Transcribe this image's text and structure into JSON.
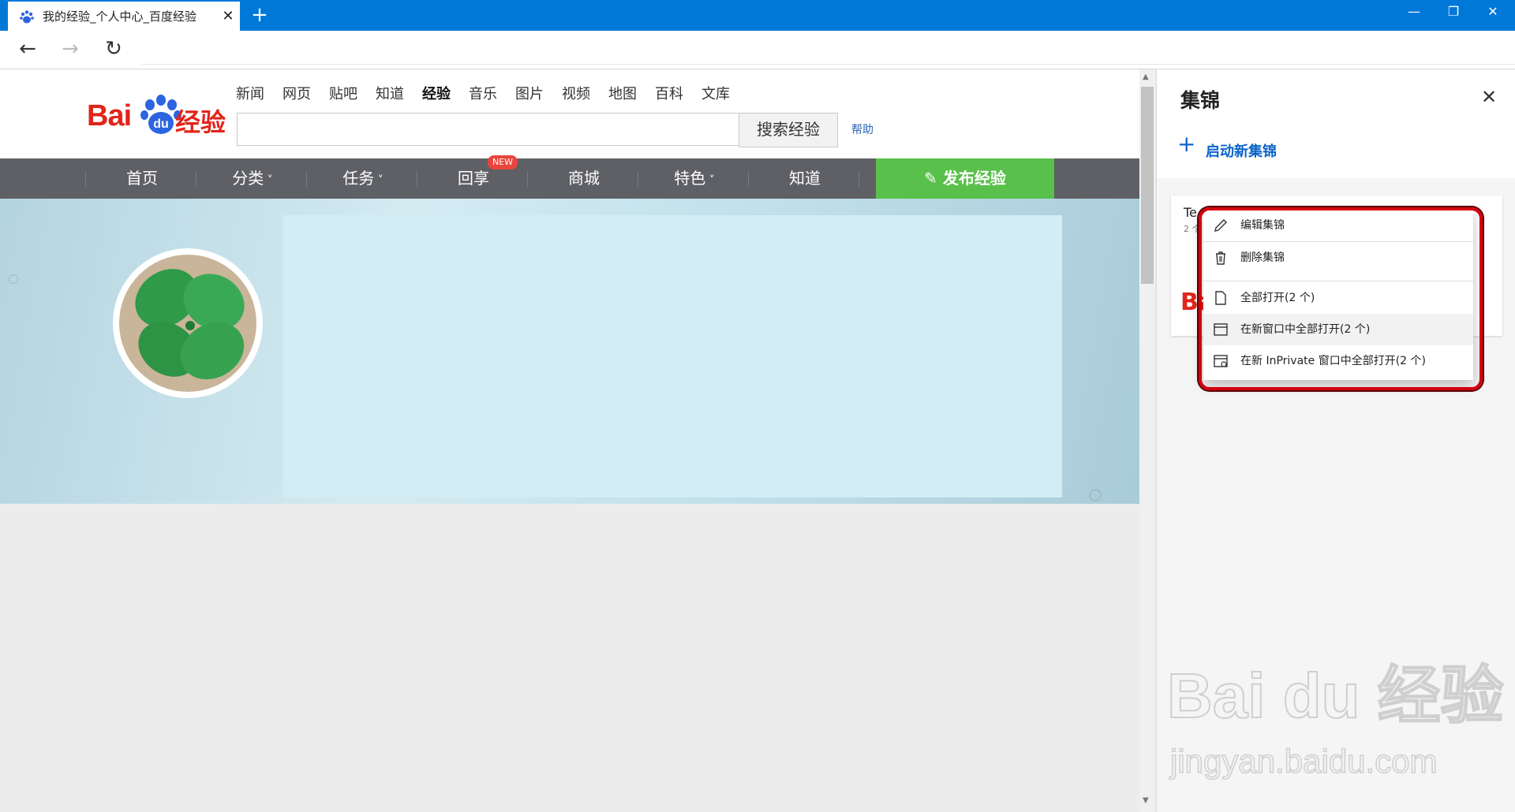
{
  "browser": {
    "tab_title": "我的经验_个人中心_百度经验",
    "tab_close": "✕",
    "new_tab": "+",
    "minimize": "—",
    "maximize": "❐",
    "close": "✕",
    "back": "←",
    "forward": "→",
    "refresh": "↻"
  },
  "site": {
    "logo_bai": "Bai",
    "logo_du": "du",
    "logo_jy": "经验",
    "top_nav": [
      "新闻",
      "网页",
      "贴吧",
      "知道",
      "经验",
      "音乐",
      "图片",
      "视频",
      "地图",
      "百科",
      "文库"
    ],
    "top_nav_active": "经验",
    "search_button": "搜索经验",
    "help_link": "帮助",
    "main_nav": [
      "首页",
      "分类",
      "任务",
      "回享",
      "商城",
      "特色",
      "知道"
    ],
    "main_nav_dropdown": [
      false,
      true,
      true,
      false,
      false,
      true,
      false
    ],
    "new_badge": "NEW",
    "publish_button": "发布经验"
  },
  "collections": {
    "title": "集锦",
    "new_collection": "启动新集锦",
    "card_title": "Te",
    "card_count": "2 个",
    "menu": {
      "edit": "编辑集锦",
      "delete": "删除集锦",
      "open_all": "全部打开(2 个)",
      "open_all_new_window": "在新窗口中全部打开(2 个)",
      "open_all_inprivate": "在新 InPrivate 窗口中全部打开(2 个)"
    }
  },
  "watermark": {
    "logo": "Bai du 经验",
    "url": "jingyan.baidu.com"
  },
  "colors": {
    "titlebar": "#0078d7",
    "brand_red": "#e1251b",
    "nav_bg": "#5f6065",
    "publish_green": "#59c04b",
    "highlight_red": "#d4000f",
    "accent_blue": "#0a64c8"
  }
}
